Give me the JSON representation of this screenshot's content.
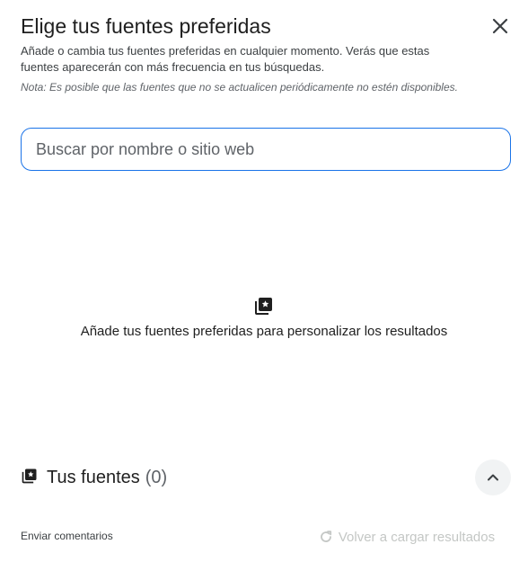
{
  "dialog": {
    "title": "Elige tus fuentes preferidas",
    "subtitle": "Añade o cambia tus fuentes preferidas en cualquier momento. Verás que estas fuentes aparecerán con más frecuencia en tus búsquedas.",
    "note": "Nota: Es posible que las fuentes que no se actualicen periódicamente no estén disponibles.",
    "close_icon": "close-icon"
  },
  "search": {
    "placeholder": "Buscar por nombre o sitio web",
    "value": ""
  },
  "empty_state": {
    "icon": "starred-sources-icon",
    "message": "Añade tus fuentes preferidas para personalizar los resultados"
  },
  "your_sources": {
    "icon": "starred-sources-icon",
    "label": "Tus fuentes",
    "count": "(0)",
    "toggle_icon": "chevron-up-icon"
  },
  "footer": {
    "feedback_label": "Enviar comentarios",
    "reload_label": "Volver a cargar resultados",
    "reload_icon": "refresh-icon"
  },
  "colors": {
    "accent": "#1a73e8",
    "text": "#1f1f1f",
    "muted": "#5f6368",
    "disabled": "#c4c7c5",
    "button_bg": "#f1f3f4"
  }
}
